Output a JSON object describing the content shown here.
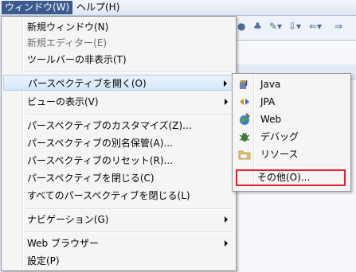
{
  "menubar": {
    "window": "ウィンドウ(W)",
    "help": "ヘルプ(H)"
  },
  "window_menu": {
    "new_window": "新規ウィンドウ(N)",
    "new_editor": "新規エディター(E)",
    "hide_toolbar": "ツールバーの非表示(T)",
    "open_perspective": "パースペクティブを開く(O)",
    "show_view": "ビューの表示(V)",
    "customize_perspective": "パースペクティブのカスタマイズ(Z)...",
    "save_perspective_as": "パースペクティブの別名保管(A)...",
    "reset_perspective": "パースペクティブのリセット(R)...",
    "close_perspective": "パースペクティブを閉じる(C)",
    "close_all_perspectives": "すべてのパースペクティブを閉じる(L)",
    "navigation": "ナビゲーション(G)",
    "web_browser": "Web ブラウザー",
    "preferences": "設定(P)"
  },
  "perspective_submenu": {
    "java": "Java",
    "jpa": "JPA",
    "web": "Web",
    "debug": "デバッグ",
    "resource": "リソース",
    "other": "その他(O)..."
  },
  "colors": {
    "highlight_border": "#e0202a",
    "menubar_active": "#3b5a8d"
  }
}
